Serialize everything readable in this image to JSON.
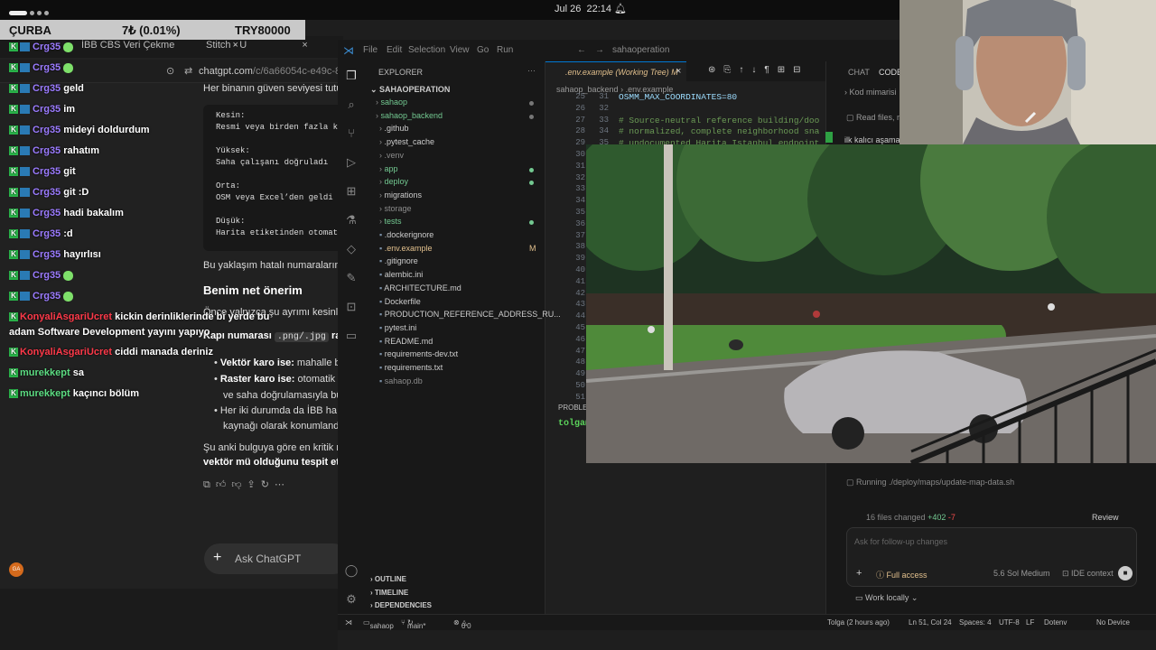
{
  "topbar": {
    "date": "Jul 26",
    "time": "22:14"
  },
  "ticker": {
    "symbol": "ÇURBA",
    "change": "7₺ (0.01%)",
    "value": "TRY80000"
  },
  "browser": {
    "tabs": [
      "İBB CBS Veri Çekme",
      "Stitch - U"
    ],
    "url_main": "chatgpt.com",
    "url_rest": "/c/6a66054c-e49c-83"
  },
  "gpt": {
    "intro": "Her binanın güven seviyesi tutul",
    "code": "Kesin:\nResmi veya birden fazla kayı\n\nYüksek:\nSaha çalışanı doğruladı\n\nOrta:\nOSM veya Excel’den geldi\n\nDüşük:\nHarita etiketinden otomatik",
    "para1": "Bu yaklaşım hatalı numaraların",
    "heading": "Benim net önerim",
    "para2": "Önce yalnızca şu ayrımı kesinle",
    "para3_pre": "Kapı numarası",
    "para3_chip": ".png/.jpg",
    "para3_post": "ras",
    "b1_bold": "Vektör karo ise:",
    "b1_rest": "mahalle b",
    "b2_bold": "Raster karo ise:",
    "b2_rest": "otomatik",
    "b2_cont": "ve saha doğrulamasıyla bü",
    "b3": "Her iki durumda da İBB ha",
    "b3_cont": "kaynağı olarak konumlandı",
    "para4": "Şu anki bulguya göre en kritik n",
    "para4_bold": "vektör mü olduğunu tespit et",
    "ask_placeholder": "Ask ChatGPT"
  },
  "chat": [
    {
      "user": "Crg35",
      "text": "",
      "type": "emote"
    },
    {
      "user": "Crg35",
      "text": "",
      "type": "emote"
    },
    {
      "user": "Crg35",
      "text": "geld",
      "type": "text"
    },
    {
      "user": "Crg35",
      "text": "im",
      "type": "text"
    },
    {
      "user": "Crg35",
      "text": "mideyi doldurdum",
      "type": "text"
    },
    {
      "user": "Crg35",
      "text": "rahatım",
      "type": "text"
    },
    {
      "user": "Crg35",
      "text": "git",
      "type": "text"
    },
    {
      "user": "Crg35",
      "text": "git :D",
      "type": "text"
    },
    {
      "user": "Crg35",
      "text": "hadi bakalım",
      "type": "text"
    },
    {
      "user": "Crg35",
      "text": ":d",
      "type": "text"
    },
    {
      "user": "Crg35",
      "text": "hayırlısı",
      "type": "text"
    },
    {
      "user": "Crg35",
      "text": "",
      "type": "emote"
    },
    {
      "user": "Crg35",
      "text": "",
      "type": "emote"
    }
  ],
  "chat2": [
    {
      "user": "KonyaliAsgariUcret",
      "text": "kickin derinliklerinde bi yerde bu"
    },
    {
      "user": "",
      "text": "adam Software Development yayını yapıyo"
    },
    {
      "user": "KonyaliAsgariUcret",
      "text": "ciddi manada deriniz"
    },
    {
      "user": "murekkept",
      "text": "sa"
    },
    {
      "user": "murekkept",
      "text": "kaçıncı bölüm"
    }
  ],
  "vscode": {
    "menu": [
      "File",
      "Edit",
      "Selection",
      "View",
      "Go",
      "Run"
    ],
    "search": "sahaoperation",
    "explorer_title": "EXPLORER",
    "root": "SAHAOPERATION",
    "tree": [
      {
        "name": "sahaop",
        "color": "g",
        "indent": 0,
        "dot": "m"
      },
      {
        "name": "sahaop_backend",
        "color": "g",
        "indent": 0,
        "dot": "m"
      },
      {
        "name": ".github",
        "color": "n",
        "indent": 1,
        "dot": ""
      },
      {
        "name": ".pytest_cache",
        "color": "n",
        "indent": 1,
        "dot": ""
      },
      {
        "name": ".venv",
        "color": "d",
        "indent": 1,
        "dot": ""
      },
      {
        "name": "app",
        "color": "g",
        "indent": 1,
        "dot": "g"
      },
      {
        "name": "deploy",
        "color": "g",
        "indent": 1,
        "dot": "g"
      },
      {
        "name": "migrations",
        "color": "n",
        "indent": 1,
        "dot": ""
      },
      {
        "name": "storage",
        "color": "d",
        "indent": 1,
        "dot": ""
      },
      {
        "name": "tests",
        "color": "g",
        "indent": 1,
        "dot": "g"
      },
      {
        "name": ".dockerignore",
        "color": "n",
        "indent": 1,
        "dot": ""
      },
      {
        "name": ".env.example",
        "color": "m",
        "indent": 1,
        "dot": "M"
      },
      {
        "name": ".gitignore",
        "color": "n",
        "indent": 1,
        "dot": ""
      },
      {
        "name": "alembic.ini",
        "color": "n",
        "indent": 1,
        "dot": ""
      },
      {
        "name": "ARCHITECTURE.md",
        "color": "n",
        "indent": 1,
        "dot": ""
      },
      {
        "name": "Dockerfile",
        "color": "n",
        "indent": 1,
        "dot": ""
      },
      {
        "name": "PRODUCTION_REFERENCE_ADDRESS_RU...",
        "color": "n",
        "indent": 1,
        "dot": ""
      },
      {
        "name": "pytest.ini",
        "color": "n",
        "indent": 1,
        "dot": ""
      },
      {
        "name": "README.md",
        "color": "n",
        "indent": 1,
        "dot": ""
      },
      {
        "name": "requirements-dev.txt",
        "color": "n",
        "indent": 1,
        "dot": ""
      },
      {
        "name": "requirements.txt",
        "color": "n",
        "indent": 1,
        "dot": ""
      },
      {
        "name": "sahaop.db",
        "color": "d",
        "indent": 1,
        "dot": ""
      }
    ],
    "sections": [
      "OUTLINE",
      "TIMELINE",
      "DEPENDENCIES"
    ],
    "tab": ".env.example (Working Tree)",
    "tab_flag": "M",
    "crumb1": "sahaop_backend",
    "crumb2": ".env.example",
    "line_nums_a": [
      "25",
      "26",
      "27",
      "28",
      "29",
      "30",
      "31",
      "32",
      "33",
      "34",
      "35",
      "36",
      "37",
      "38",
      "39",
      "40",
      "41",
      "42",
      "43",
      "44",
      "45",
      "46",
      "47",
      "48",
      "49",
      "50",
      "51"
    ],
    "line_nums_b": [
      "31",
      "32",
      "33",
      "34",
      "35"
    ],
    "code": [
      "OSMM_MAX_COORDINATES=80",
      "",
      "# Source-neutral reference building/doo",
      "# normalized, complete neighborhood sna",
      "# undocumented Harita Istanbul endpoint"
    ],
    "problems": "PROBLE",
    "terminal": "tolga@"
  },
  "panel": {
    "tabs": [
      "CHAT",
      "CODEX"
    ],
    "line1": "Kod mimarisi",
    "line2": "Read files, r",
    "line3": "ilk kalıcı aşamay",
    "running": "Running ./deploy/maps/update-map-data.sh",
    "files_changed": "16 files changed",
    "added": "+402",
    "removed": "-7",
    "review": "Review",
    "followup": "Ask for follow-up changes",
    "access": "Full access",
    "model": "5.6 Sol  Medium",
    "ide": "IDE context",
    "work": "Work locally"
  },
  "status": {
    "branch": "main*",
    "repo": "sahaop",
    "errors": "0",
    "warnings": "0",
    "blame": "Tolga (2 hours ago)",
    "pos": "Ln 51, Col 24",
    "spaces": "Spaces: 4",
    "enc": "UTF-8",
    "eol": "LF",
    "lang": "Dotenv",
    "device": "No Device"
  },
  "colors": {
    "accent": "#73c991",
    "modified": "#e2c08d",
    "vsbg": "#1f1f1f",
    "kick": "#2ab44a"
  }
}
